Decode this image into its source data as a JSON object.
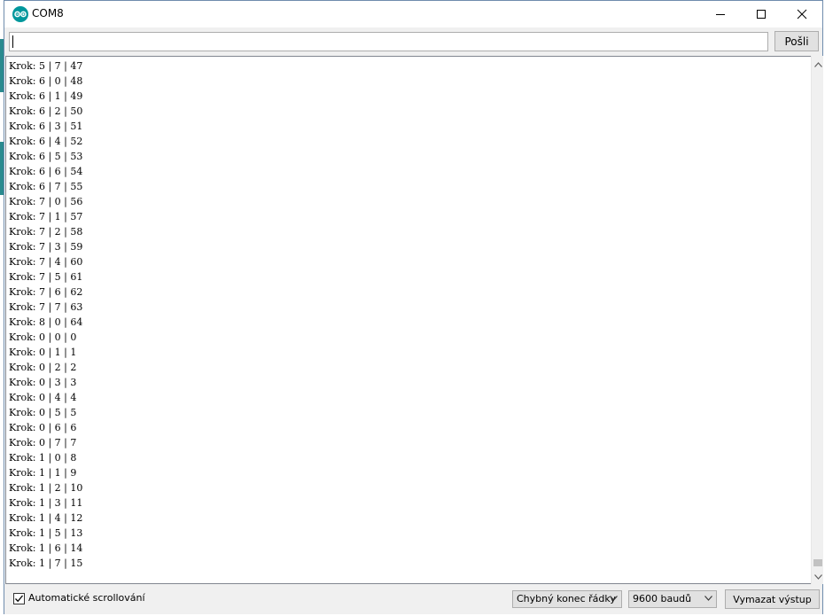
{
  "window": {
    "title": "COM8",
    "accent": "#00979c"
  },
  "send": {
    "input_value": "",
    "button_label": "Pošli"
  },
  "output": {
    "lines": [
      "Krok: 5 | 7 | 47",
      "Krok: 6 | 0 | 48",
      "Krok: 6 | 1 | 49",
      "Krok: 6 | 2 | 50",
      "Krok: 6 | 3 | 51",
      "Krok: 6 | 4 | 52",
      "Krok: 6 | 5 | 53",
      "Krok: 6 | 6 | 54",
      "Krok: 6 | 7 | 55",
      "Krok: 7 | 0 | 56",
      "Krok: 7 | 1 | 57",
      "Krok: 7 | 2 | 58",
      "Krok: 7 | 3 | 59",
      "Krok: 7 | 4 | 60",
      "Krok: 7 | 5 | 61",
      "Krok: 7 | 6 | 62",
      "Krok: 7 | 7 | 63",
      "Krok: 8 | 0 | 64",
      "Krok: 0 | 0 | 0",
      "Krok: 0 | 1 | 1",
      "Krok: 0 | 2 | 2",
      "Krok: 0 | 3 | 3",
      "Krok: 0 | 4 | 4",
      "Krok: 0 | 5 | 5",
      "Krok: 0 | 6 | 6",
      "Krok: 0 | 7 | 7",
      "Krok: 1 | 0 | 8",
      "Krok: 1 | 1 | 9",
      "Krok: 1 | 2 | 10",
      "Krok: 1 | 3 | 11",
      "Krok: 1 | 4 | 12",
      "Krok: 1 | 5 | 13",
      "Krok: 1 | 6 | 14",
      "Krok: 1 | 7 | 15"
    ]
  },
  "status": {
    "autoscroll_label": "Automatické scrollování",
    "autoscroll_checked": true,
    "line_ending": "Chybný konec řádky",
    "baud_rate": "9600 baudů",
    "clear_button": "Vymazat výstup"
  },
  "icons": {
    "app": "arduino-icon",
    "minimize": "minimize-icon",
    "maximize": "maximize-icon",
    "close": "close-icon",
    "scroll_up": "chevron-up-icon",
    "scroll_down": "chevron-down-icon",
    "checkbox": "checkmark-icon",
    "dropdown": "chevron-down-icon"
  }
}
